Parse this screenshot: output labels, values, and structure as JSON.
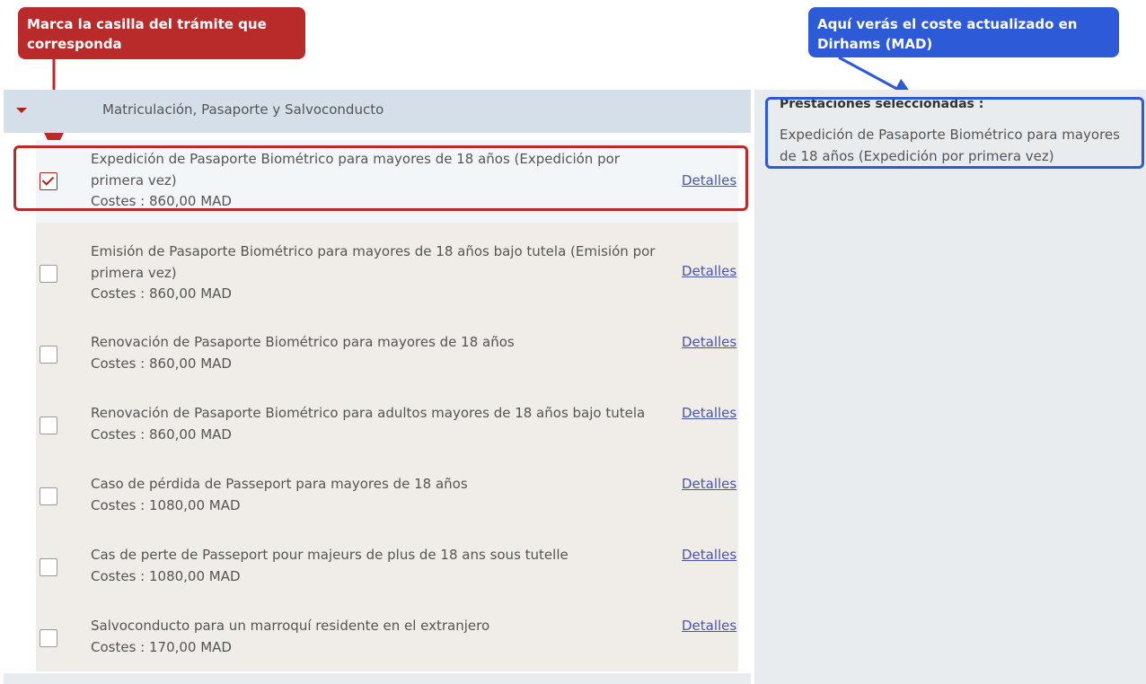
{
  "callouts": {
    "left": "Marca la casilla del trámite que corresponda",
    "right": "Aquí verás el coste actualizado en Dirhams (MAD)"
  },
  "section": {
    "title": "Matriculación, Pasaporte y Salvoconducto"
  },
  "items": [
    {
      "title": "Expedición de Pasaporte Biométrico para mayores de 18 años (Expedición por primera vez)",
      "cost": "Costes : 860,00 MAD",
      "details": "Detalles",
      "checked": true
    },
    {
      "title": "Emisión de Pasaporte Biométrico para mayores de 18 años bajo tutela (Emisión por primera vez)",
      "cost": "Costes : 860,00 MAD",
      "details": "Detalles",
      "checked": false
    },
    {
      "title": "Renovación de Pasaporte Biométrico para mayores de 18 años",
      "cost": "Costes : 860,00 MAD",
      "details": "Detalles",
      "checked": false
    },
    {
      "title": "Renovación de Pasaporte Biométrico para adultos mayores de 18 años bajo tutela",
      "cost": "Costes : 860,00 MAD",
      "details": "Detalles",
      "checked": false
    },
    {
      "title": "Caso de pérdida de Passeport para mayores de 18 años",
      "cost": "Costes : 1080,00 MAD",
      "details": "Detalles",
      "checked": false
    },
    {
      "title": "Cas de perte de Passeport pour majeurs de plus de 18 ans sous tutelle",
      "cost": "Costes : 1080,00 MAD",
      "details": "Detalles",
      "checked": false
    },
    {
      "title": "Salvoconducto para un marroquí residente en el extranjero",
      "cost": "Costes : 170,00 MAD",
      "details": "Detalles",
      "checked": false
    }
  ],
  "selected": {
    "heading": "Prestaciones seleccionadas :",
    "text": "Expedición de Pasaporte Biométrico para mayores de 18 años (Expedición por primera vez)"
  },
  "colors": {
    "callout_red": "#b92a2a",
    "callout_blue": "#2d5bd8",
    "link": "#4a55a8"
  }
}
